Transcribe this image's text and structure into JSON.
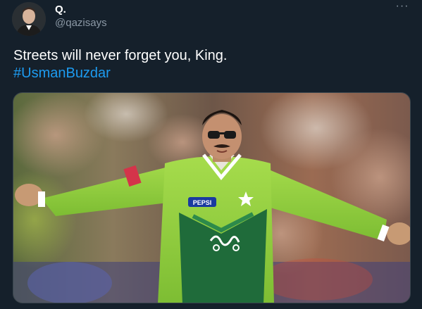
{
  "author": {
    "display_name": "Q.",
    "handle": "@qazisays",
    "avatar_icon": "profile-photo"
  },
  "more_options_label": "···",
  "tweet": {
    "text": "Streets will never forget you, King.",
    "hashtag": "#UsmanBuzdar"
  },
  "media": {
    "icon": "photo-cricketer-celebrating",
    "jersey_sponsor_text": "PEPSI",
    "colors": {
      "jersey": "#8fcf3c",
      "jersey_dark": "#1f6b3a",
      "background": "#15202b",
      "link": "#1d9bf0"
    }
  }
}
